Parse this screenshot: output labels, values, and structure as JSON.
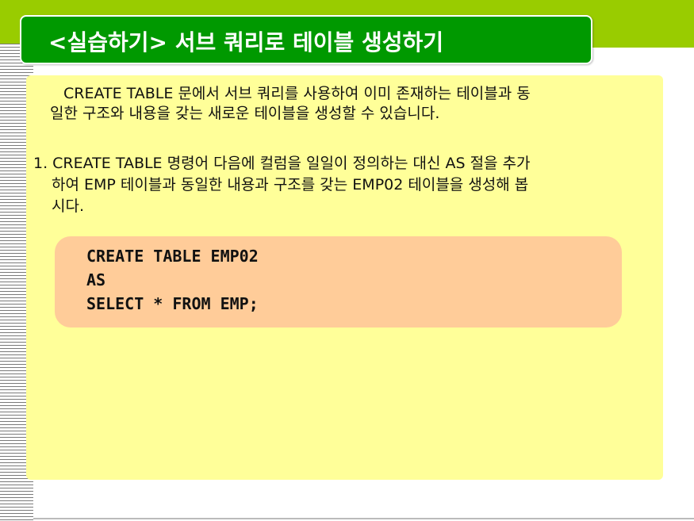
{
  "slide": {
    "title": "<실습하기> 서브 쿼리로 테이블 생성하기",
    "intro_line1": "CREATE TABLE 문에서 서브 쿼리를 사용하여 이미 존재하는 테이블과 동",
    "intro_line2": "일한 구조와 내용을 갖는 새로운 테이블을 생성할 수 있습니다.",
    "step1_line1": "1. CREATE TABLE 명령어 다음에 컬럼을 일일이 정의하는 대신 AS 절을 추가",
    "step1_line2": "하여 EMP 테이블과 동일한 내용과 구조를 갖는 EMP02 테이블을 생성해 봅",
    "step1_line3": "시다.",
    "code": [
      "CREATE TABLE EMP02",
      "AS",
      "SELECT * FROM EMP;"
    ]
  },
  "colors": {
    "header_band": "#99cc00",
    "title_box": "#009900",
    "content_bg": "#ffff99",
    "code_bg": "#ffcc99"
  }
}
